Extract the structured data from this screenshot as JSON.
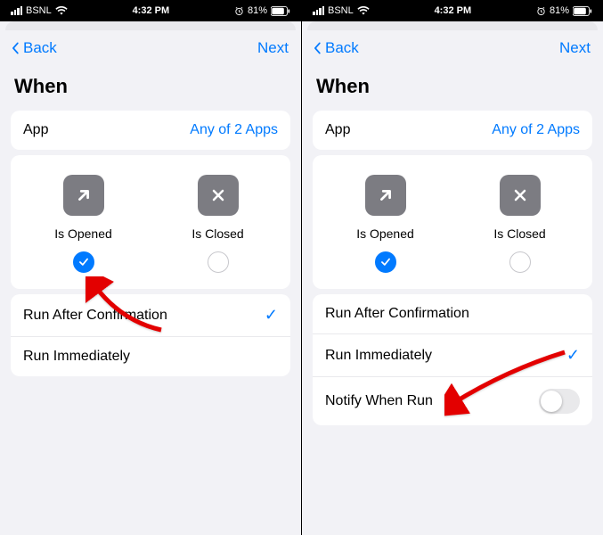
{
  "left": {
    "status": {
      "carrier": "BSNL",
      "time": "4:32 PM",
      "battery": "81%"
    },
    "nav": {
      "back": "Back",
      "next": "Next"
    },
    "title": "When",
    "app_row": {
      "label": "App",
      "value": "Any of 2 Apps"
    },
    "options": {
      "opened": {
        "label": "Is Opened",
        "checked": true
      },
      "closed": {
        "label": "Is Closed",
        "checked": false
      }
    },
    "run_rows": {
      "after_confirm": {
        "label": "Run After Confirmation",
        "checked": true
      },
      "immediately": {
        "label": "Run Immediately",
        "checked": false
      }
    }
  },
  "right": {
    "status": {
      "carrier": "BSNL",
      "time": "4:32 PM",
      "battery": "81%"
    },
    "nav": {
      "back": "Back",
      "next": "Next"
    },
    "title": "When",
    "app_row": {
      "label": "App",
      "value": "Any of 2 Apps"
    },
    "options": {
      "opened": {
        "label": "Is Opened",
        "checked": true
      },
      "closed": {
        "label": "Is Closed",
        "checked": false
      }
    },
    "run_rows": {
      "after_confirm": {
        "label": "Run After Confirmation",
        "checked": false
      },
      "immediately": {
        "label": "Run Immediately",
        "checked": true
      },
      "notify": {
        "label": "Notify When Run",
        "on": false
      }
    }
  }
}
